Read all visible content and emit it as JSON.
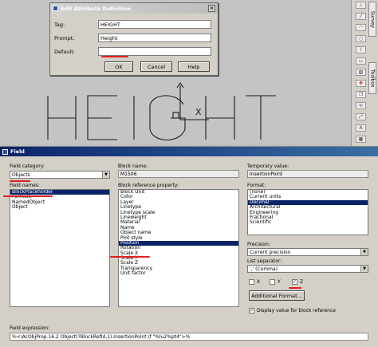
{
  "canvas": {
    "drawn_text": "HEIGHT",
    "cursor_label": "X"
  },
  "toolbar_right": {
    "tab_survey": "Survey",
    "tab_toolbox": "Toolbox"
  },
  "attr_dialog": {
    "title": "Edit Attribute Definition",
    "tag_label": "Tag:",
    "tag_value": "HEIGHT",
    "prompt_label": "Prompt:",
    "prompt_value": "Height",
    "default_label": "Default:",
    "default_value": "",
    "ok_label": "OK",
    "cancel_label": "Cancel",
    "help_label": "Help"
  },
  "field_dialog": {
    "title": "Field",
    "category_label": "Field category:",
    "category_value": "Objects",
    "names_label": "Field names:",
    "field_names": [
      {
        "label": "BlockPlaceholder",
        "selected": true
      },
      {
        "label": "Formula",
        "selected": false
      },
      {
        "label": "NamedObject",
        "selected": false
      },
      {
        "label": "Object",
        "selected": false
      }
    ],
    "block_name_label": "Block name:",
    "block_name_value": "M1506",
    "block_ref_label": "Block reference property:",
    "block_properties": [
      {
        "label": "Block Unit",
        "selected": false
      },
      {
        "label": "Color",
        "selected": false
      },
      {
        "label": "Layer",
        "selected": false
      },
      {
        "label": "Linetype",
        "selected": false
      },
      {
        "label": "Linetype scale",
        "selected": false
      },
      {
        "label": "Lineweight",
        "selected": false
      },
      {
        "label": "Material",
        "selected": false
      },
      {
        "label": "Name",
        "selected": false
      },
      {
        "label": "Object name",
        "selected": false
      },
      {
        "label": "Plot style",
        "selected": false
      },
      {
        "label": "Position",
        "selected": true
      },
      {
        "label": "Rotation",
        "selected": false
      },
      {
        "label": "Scale X",
        "selected": false
      },
      {
        "label": "Scale Y",
        "selected": false
      },
      {
        "label": "Scale Z",
        "selected": false
      },
      {
        "label": "Transparency",
        "selected": false
      },
      {
        "label": "Unit factor",
        "selected": false
      }
    ],
    "temp_value_label": "Temporary value:",
    "temp_value": "InsertionPoint",
    "format_label": "Format:",
    "formats": [
      {
        "label": "(none)",
        "selected": false
      },
      {
        "label": "Current units",
        "selected": false
      },
      {
        "label": "Decimal",
        "selected": true
      },
      {
        "label": "Architectural",
        "selected": false
      },
      {
        "label": "Engineering",
        "selected": false
      },
      {
        "label": "Fractional",
        "selected": false
      },
      {
        "label": "Scientific",
        "selected": false
      }
    ],
    "precision_label": "Precision:",
    "precision_value": "Current precision",
    "separator_label": "List separator:",
    "separator_value": "',' (Comma)",
    "chk_x_label": "X",
    "chk_x": false,
    "chk_y_label": "Y",
    "chk_y": false,
    "chk_z_label": "Z",
    "chk_z": true,
    "additional_format_label": "Additional Format...",
    "display_value_label": "Display value for block reference",
    "display_value_checked": true,
    "expression_label": "Field expression:",
    "expression_value": "%<\\AcObjProp.16.2 Object(?BlockRefId,1).InsertionPoint \\f \"%lu2%pt4\">%"
  },
  "colors": {
    "selection": "#0a246a",
    "annotation_red": "#e02020",
    "dialog_face": "#d4d0c8"
  }
}
